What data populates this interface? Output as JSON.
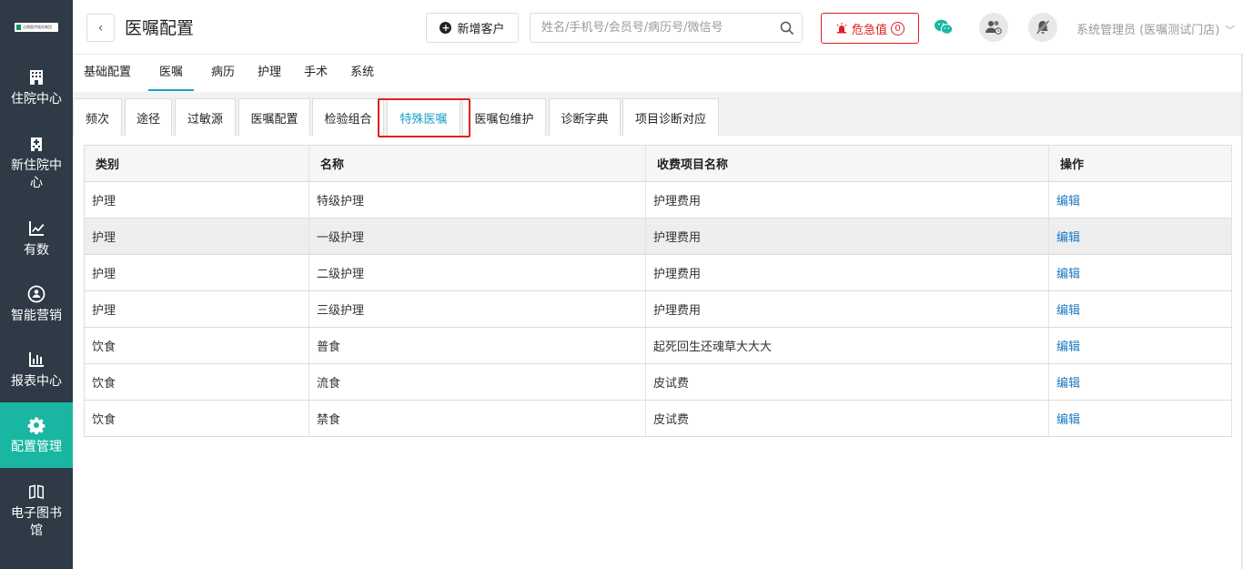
{
  "logo": {
    "text": "洁雅酷特服务集团"
  },
  "sidebar": {
    "items": [
      {
        "label": "住院中心",
        "icon": "hospital-building-icon",
        "active": false
      },
      {
        "label": "新住院中心",
        "icon": "new-hospital-icon",
        "active": false
      },
      {
        "label": "有数",
        "icon": "trend-chart-icon",
        "active": false
      },
      {
        "label": "智能营销",
        "icon": "marketing-icon",
        "active": false
      },
      {
        "label": "报表中心",
        "icon": "bar-report-icon",
        "active": false
      },
      {
        "label": "配置管理",
        "icon": "gear-icon",
        "active": true
      },
      {
        "label": "电子图书馆",
        "icon": "book-icon",
        "active": false
      }
    ]
  },
  "header": {
    "back": "‹",
    "title": "医嘱配置",
    "new_customer": "新增客户",
    "search_placeholder": "姓名/手机号/会员号/病历号/微信号",
    "danger_label": "危急值",
    "danger_count": "0",
    "user": "系统管理员 (医嘱测试门店)"
  },
  "menu_tabs": [
    {
      "label": "基础配置",
      "active": false
    },
    {
      "label": "医嘱",
      "active": true
    },
    {
      "label": "病历",
      "active": false
    },
    {
      "label": "护理",
      "active": false
    },
    {
      "label": "手术",
      "active": false
    },
    {
      "label": "系统",
      "active": false
    }
  ],
  "sub_tabs": [
    {
      "label": "频次",
      "active": false
    },
    {
      "label": "途径",
      "active": false
    },
    {
      "label": "过敏源",
      "active": false
    },
    {
      "label": "医嘱配置",
      "active": false
    },
    {
      "label": "检验组合",
      "active": false
    },
    {
      "label": "特殊医嘱",
      "active": true
    },
    {
      "label": "医嘱包维护",
      "active": false
    },
    {
      "label": "诊断字典",
      "active": false
    },
    {
      "label": "项目诊断对应",
      "active": false
    }
  ],
  "table": {
    "columns": [
      "类别",
      "名称",
      "收费项目名称",
      "操作"
    ],
    "rows": [
      [
        "护理",
        "特级护理",
        "护理费用",
        "编辑"
      ],
      [
        "护理",
        "一级护理",
        "护理费用",
        "编辑"
      ],
      [
        "护理",
        "二级护理",
        "护理费用",
        "编辑"
      ],
      [
        "护理",
        "三级护理",
        "护理费用",
        "编辑"
      ],
      [
        "饮食",
        "普食",
        "起死回生还魂草大大大",
        "编辑"
      ],
      [
        "饮食",
        "流食",
        "皮试费",
        "编辑"
      ],
      [
        "饮食",
        "禁食",
        "皮试费",
        "编辑"
      ]
    ]
  },
  "colors": {
    "sidebar_bg": "#2e3a45",
    "sidebar_active": "#19b7a1",
    "accent": "#19a0c8",
    "danger": "#e02020",
    "link": "#1a78c2"
  }
}
